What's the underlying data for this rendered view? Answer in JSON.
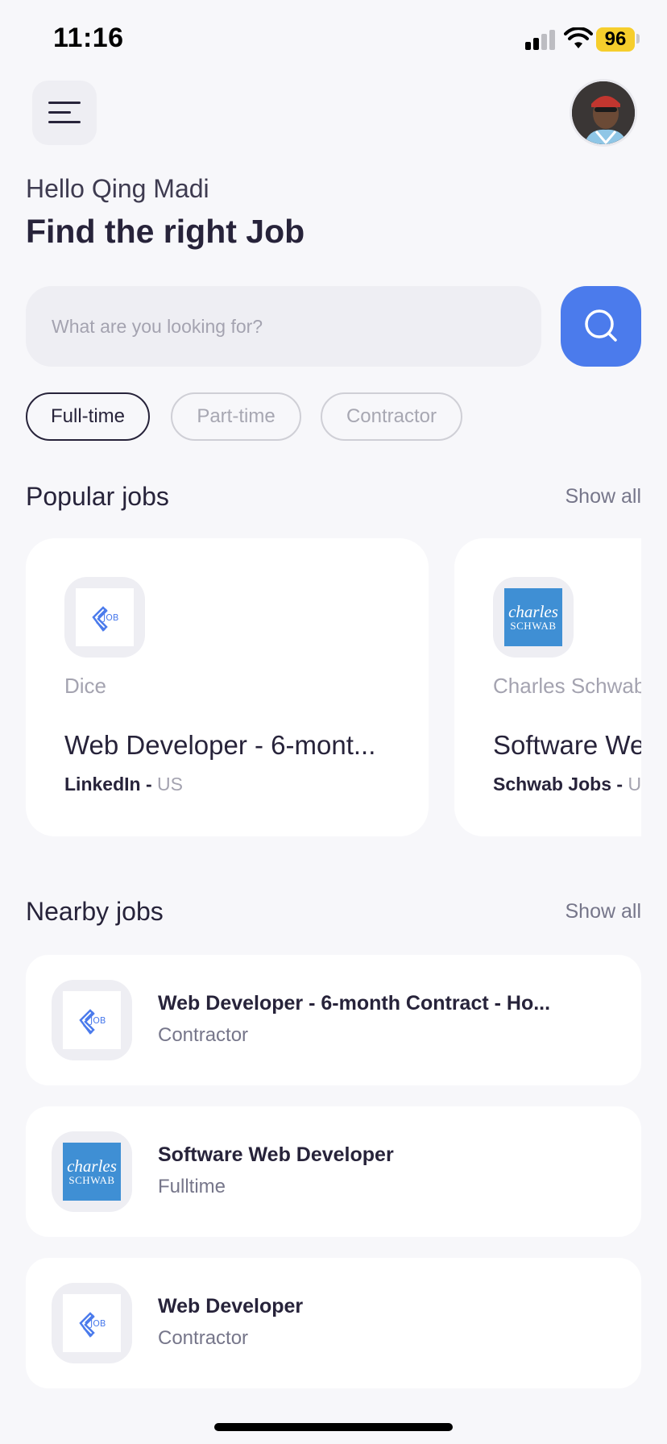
{
  "status_bar": {
    "time": "11:16",
    "battery": "96"
  },
  "header": {
    "greeting": "Hello Qing Madi",
    "title": "Find the right Job"
  },
  "search": {
    "placeholder": "What are you looking for?"
  },
  "filters": [
    {
      "label": "Full-time",
      "active": true
    },
    {
      "label": "Part-time",
      "active": false
    },
    {
      "label": "Contractor",
      "active": false
    }
  ],
  "popular": {
    "title": "Popular jobs",
    "show_all": "Show all",
    "items": [
      {
        "company": "Dice",
        "title": "Web Developer - 6-mont...",
        "source": "LinkedIn - ",
        "location": "US",
        "logo": "job-logo-icon"
      },
      {
        "company": "Charles Schwab",
        "title": "Software Web Developer",
        "source": "Schwab Jobs - ",
        "location": "US",
        "logo": "charles-schwab-logo"
      }
    ]
  },
  "nearby": {
    "title": "Nearby jobs",
    "show_all": "Show all",
    "items": [
      {
        "title": "Web Developer - 6-month Contract - Ho...",
        "type": "Contractor",
        "logo": "job-logo-icon"
      },
      {
        "title": "Software Web Developer",
        "type": "Fulltime",
        "logo": "charles-schwab-logo"
      },
      {
        "title": "Web Developer",
        "type": "Contractor",
        "logo": "job-logo-icon"
      }
    ]
  },
  "logos": {
    "schwab_line1": "charles",
    "schwab_line2": "SCHWAB"
  },
  "colors": {
    "accent": "#4B7BEC",
    "background": "#F7F7FA",
    "text": "#27233A",
    "battery": "#F6CE2C"
  }
}
